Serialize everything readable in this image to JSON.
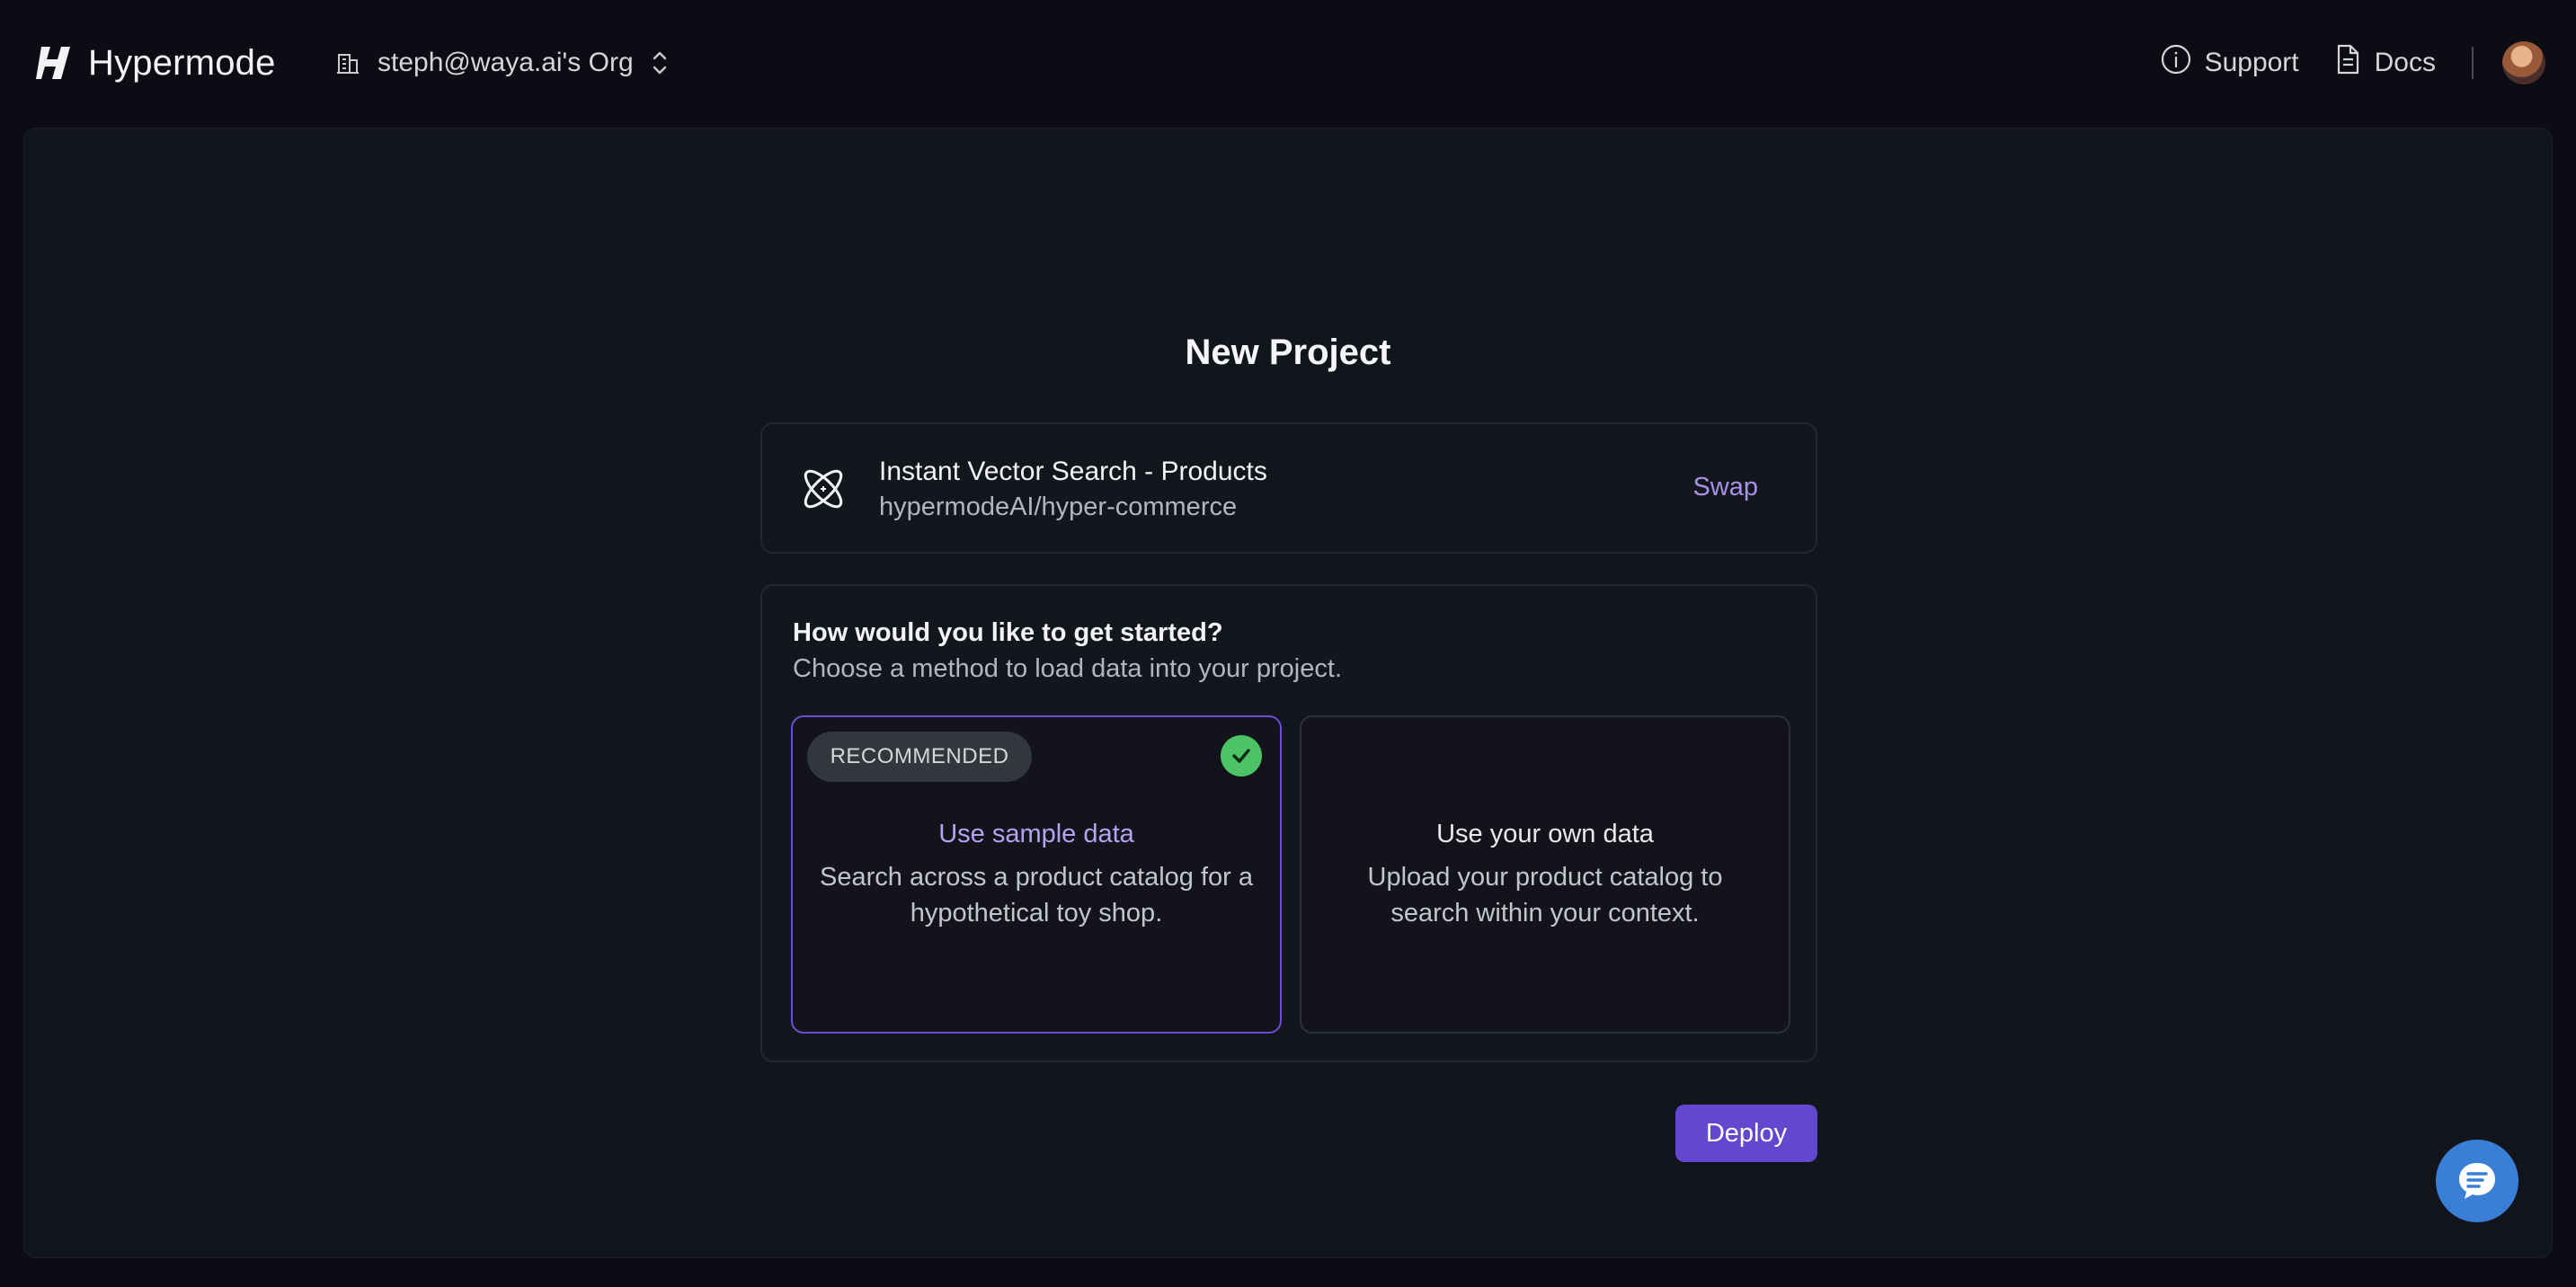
{
  "header": {
    "brand_name": "Hypermode",
    "org_name": "steph@waya.ai's Org",
    "support_label": "Support",
    "docs_label": "Docs"
  },
  "page": {
    "title": "New Project"
  },
  "template": {
    "title": "Instant Vector Search - Products",
    "repo": "hypermodeAI/hyper-commerce",
    "swap_label": "Swap",
    "icon": "atom-icon"
  },
  "get_started": {
    "heading": "How would you like to get started?",
    "subheading": "Choose a method to load data into your project.",
    "options": [
      {
        "badge": "RECOMMENDED",
        "title": "Use sample data",
        "description": "Search across a product catalog for a hypothetical toy shop.",
        "selected": true
      },
      {
        "title": "Use your own data",
        "description": "Upload your product catalog to search within your context.",
        "selected": false
      }
    ]
  },
  "actions": {
    "deploy_label": "Deploy"
  },
  "colors": {
    "accent": "#6247cf",
    "accent_text": "#a892e6",
    "success": "#4cc364",
    "chat": "#3a7fd6"
  }
}
